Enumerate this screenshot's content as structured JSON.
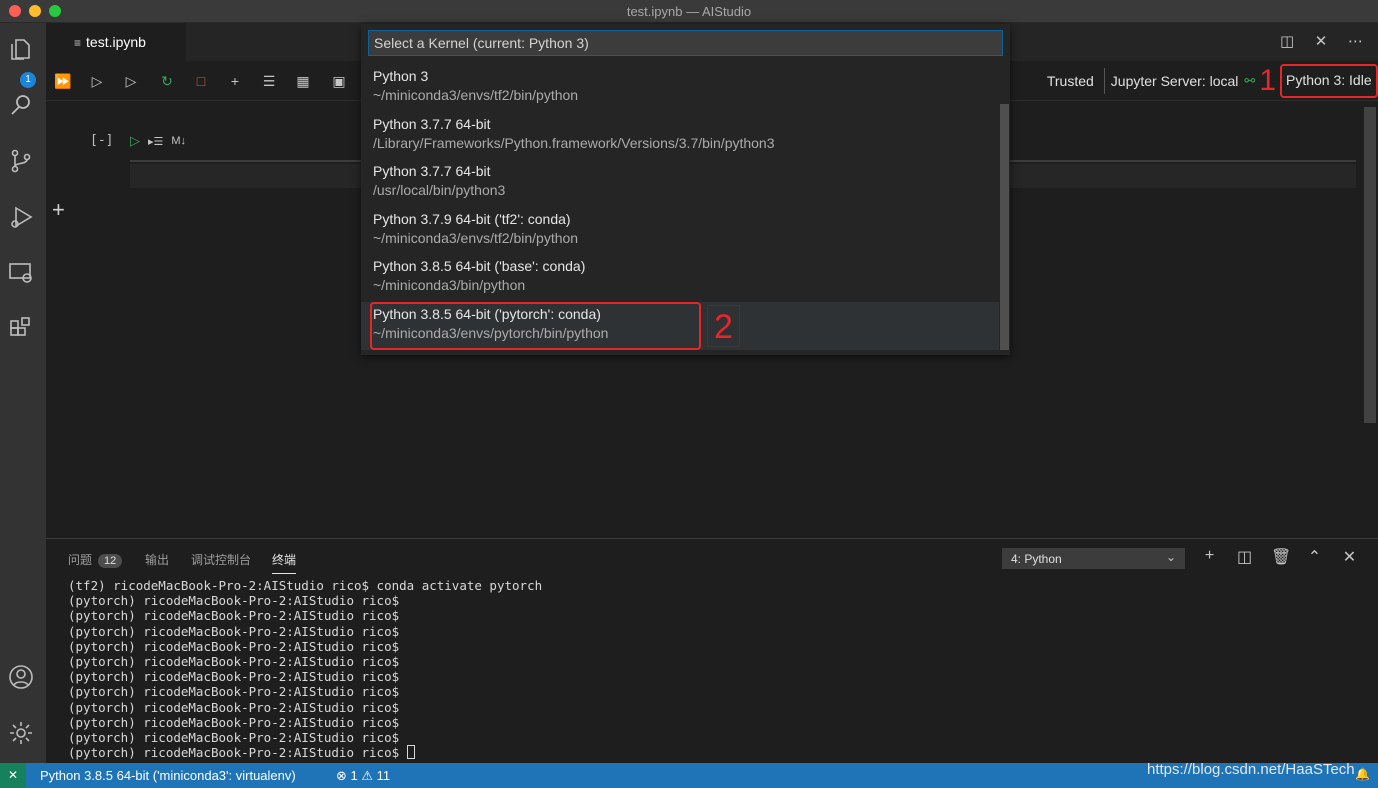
{
  "window": {
    "title": "test.ipynb — AIStudio"
  },
  "activity": {
    "explorer_badge": "1"
  },
  "editor": {
    "tab_label": "test.ipynb",
    "trusted": "Trusted",
    "jupyter_server": "Jupyter Server: local",
    "annotation_1": "1",
    "kernel_status": "Python 3: Idle",
    "cell_exec_count": "[-]",
    "cell_md_label": "M↓"
  },
  "kernel_picker": {
    "placeholder": "Select a Kernel (current: Python 3)",
    "items": [
      {
        "label": "Python 3",
        "path": "~/miniconda3/envs/tf2/bin/python"
      },
      {
        "label": "Python 3.7.7 64-bit",
        "path": "/Library/Frameworks/Python.framework/Versions/3.7/bin/python3"
      },
      {
        "label": "Python 3.7.7 64-bit",
        "path": "/usr/local/bin/python3"
      },
      {
        "label": "Python 3.7.9 64-bit ('tf2': conda)",
        "path": "~/miniconda3/envs/tf2/bin/python"
      },
      {
        "label": "Python 3.8.5 64-bit ('base': conda)",
        "path": "~/miniconda3/bin/python"
      },
      {
        "label": "Python 3.8.5 64-bit ('pytorch': conda)",
        "path": "~/miniconda3/envs/pytorch/bin/python"
      }
    ],
    "annotation_2": "2"
  },
  "panel": {
    "tabs": [
      {
        "label": "问题",
        "count": "12"
      },
      {
        "label": "输出"
      },
      {
        "label": "调试控制台"
      },
      {
        "label": "终端"
      }
    ],
    "terminal_select": "4: Python",
    "terminal_lines": [
      "(tf2) ricodeMacBook-Pro-2:AIStudio rico$ conda activate pytorch",
      "(pytorch) ricodeMacBook-Pro-2:AIStudio rico$",
      "(pytorch) ricodeMacBook-Pro-2:AIStudio rico$",
      "(pytorch) ricodeMacBook-Pro-2:AIStudio rico$",
      "(pytorch) ricodeMacBook-Pro-2:AIStudio rico$",
      "(pytorch) ricodeMacBook-Pro-2:AIStudio rico$",
      "(pytorch) ricodeMacBook-Pro-2:AIStudio rico$",
      "(pytorch) ricodeMacBook-Pro-2:AIStudio rico$",
      "(pytorch) ricodeMacBook-Pro-2:AIStudio rico$",
      "(pytorch) ricodeMacBook-Pro-2:AIStudio rico$",
      "(pytorch) ricodeMacBook-Pro-2:AIStudio rico$",
      "(pytorch) ricodeMacBook-Pro-2:AIStudio rico$ "
    ]
  },
  "statusbar": {
    "interpreter": "Python 3.8.5 64-bit ('miniconda3': virtualenv)",
    "problems": "⊗ 1 ⚠ 11",
    "watermark": "https://blog.csdn.net/HaaSTech"
  },
  "colors": {
    "accent": "#1f73b7",
    "highlight": "#e8262a",
    "remote": "#16825d"
  }
}
